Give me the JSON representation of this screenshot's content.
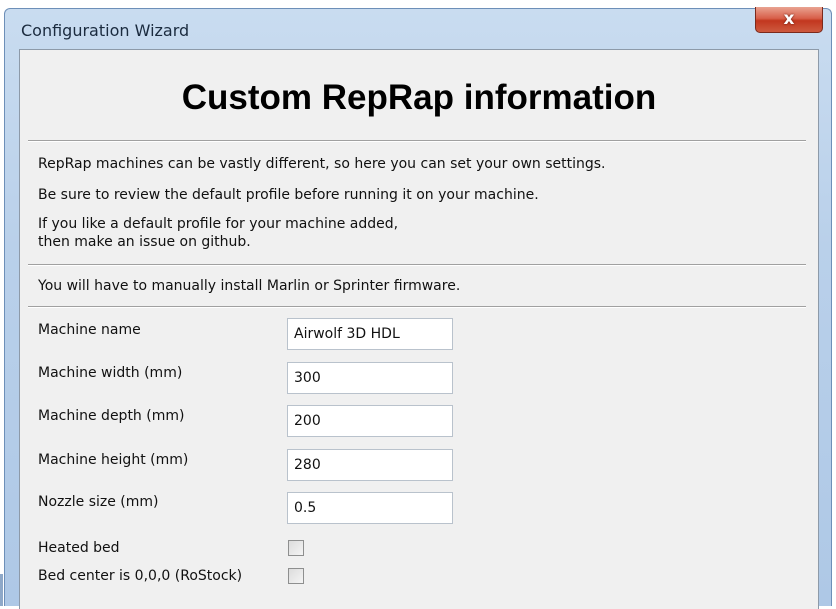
{
  "window": {
    "title": "Configuration Wizard",
    "close_glyph": "x"
  },
  "page": {
    "heading": "Custom RepRap information",
    "description_lines": [
      "RepRap machines can be vastly different, so here you can set your own settings.",
      "Be sure to review the default profile before running it on your machine.",
      "If you like a default profile for your machine added,",
      "then make an issue on github."
    ],
    "firmware_note": "You will have to manually install Marlin or Sprinter firmware."
  },
  "form": {
    "fields": [
      {
        "label": "Machine name",
        "value": "Airwolf 3D HDL"
      },
      {
        "label": "Machine width (mm)",
        "value": "300"
      },
      {
        "label": "Machine depth (mm)",
        "value": "200"
      },
      {
        "label": "Machine height (mm)",
        "value": "280"
      },
      {
        "label": "Nozzle size (mm)",
        "value": "0.5"
      }
    ],
    "checkboxes": [
      {
        "label": "Heated bed",
        "checked": false
      },
      {
        "label": "Bed center is 0,0,0 (RoStock)",
        "checked": false
      }
    ]
  },
  "colors": {
    "titlebar": "#b9d0ea",
    "close_button": "#c2371f",
    "panel_background": "#f0f0f0"
  }
}
